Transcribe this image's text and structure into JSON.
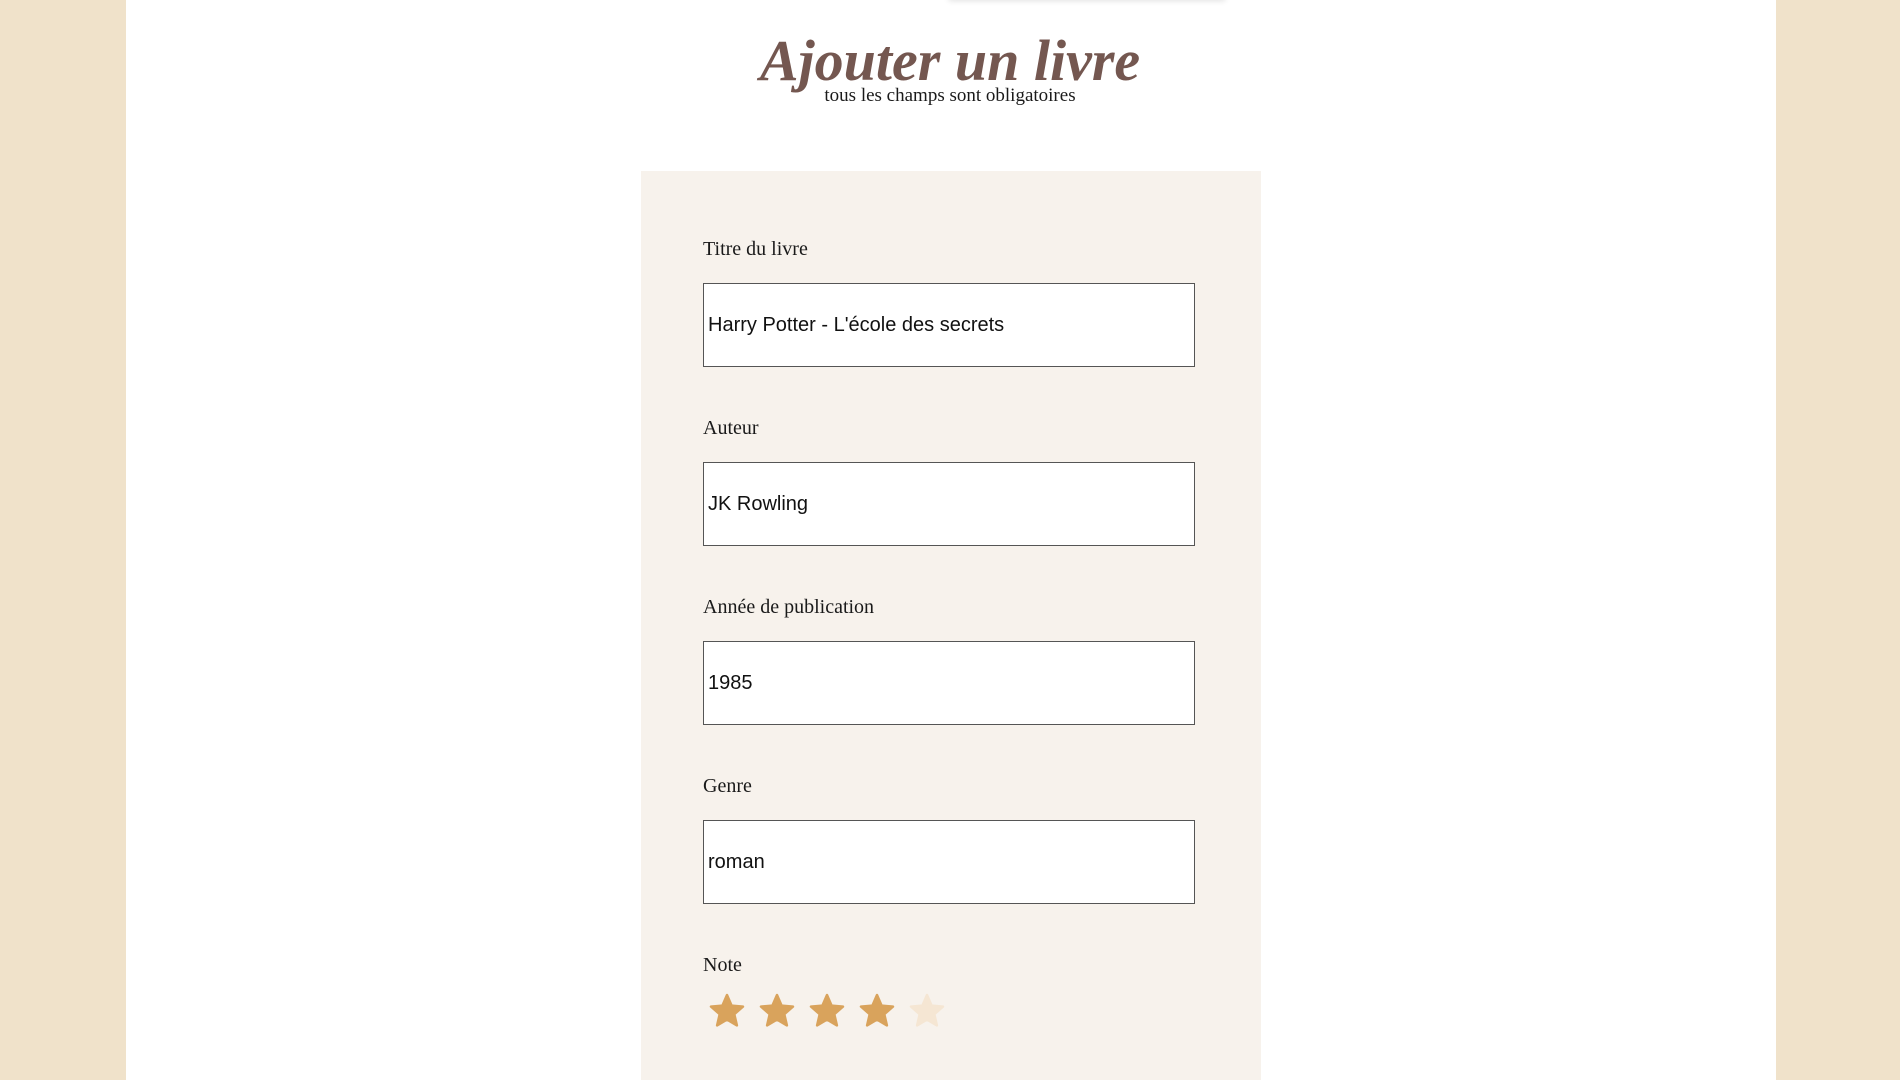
{
  "header": {
    "title": "Ajouter un livre",
    "subtitle": "tous les champs sont obligatoires"
  },
  "form": {
    "fields": [
      {
        "label": "Titre du livre",
        "value": "Harry Potter - L'école des secrets"
      },
      {
        "label": "Auteur",
        "value": "JK Rowling"
      },
      {
        "label": "Année de publication",
        "value": "1985"
      },
      {
        "label": "Genre",
        "value": "roman"
      }
    ],
    "rating": {
      "label": "Note",
      "value": 4,
      "max": 5
    }
  },
  "colors": {
    "page_background": "#f0e2ca",
    "card_background": "#f7f2ec",
    "title_color": "#745750",
    "star_filled": "#d9a35c",
    "star_empty": "#f5e6d3"
  }
}
